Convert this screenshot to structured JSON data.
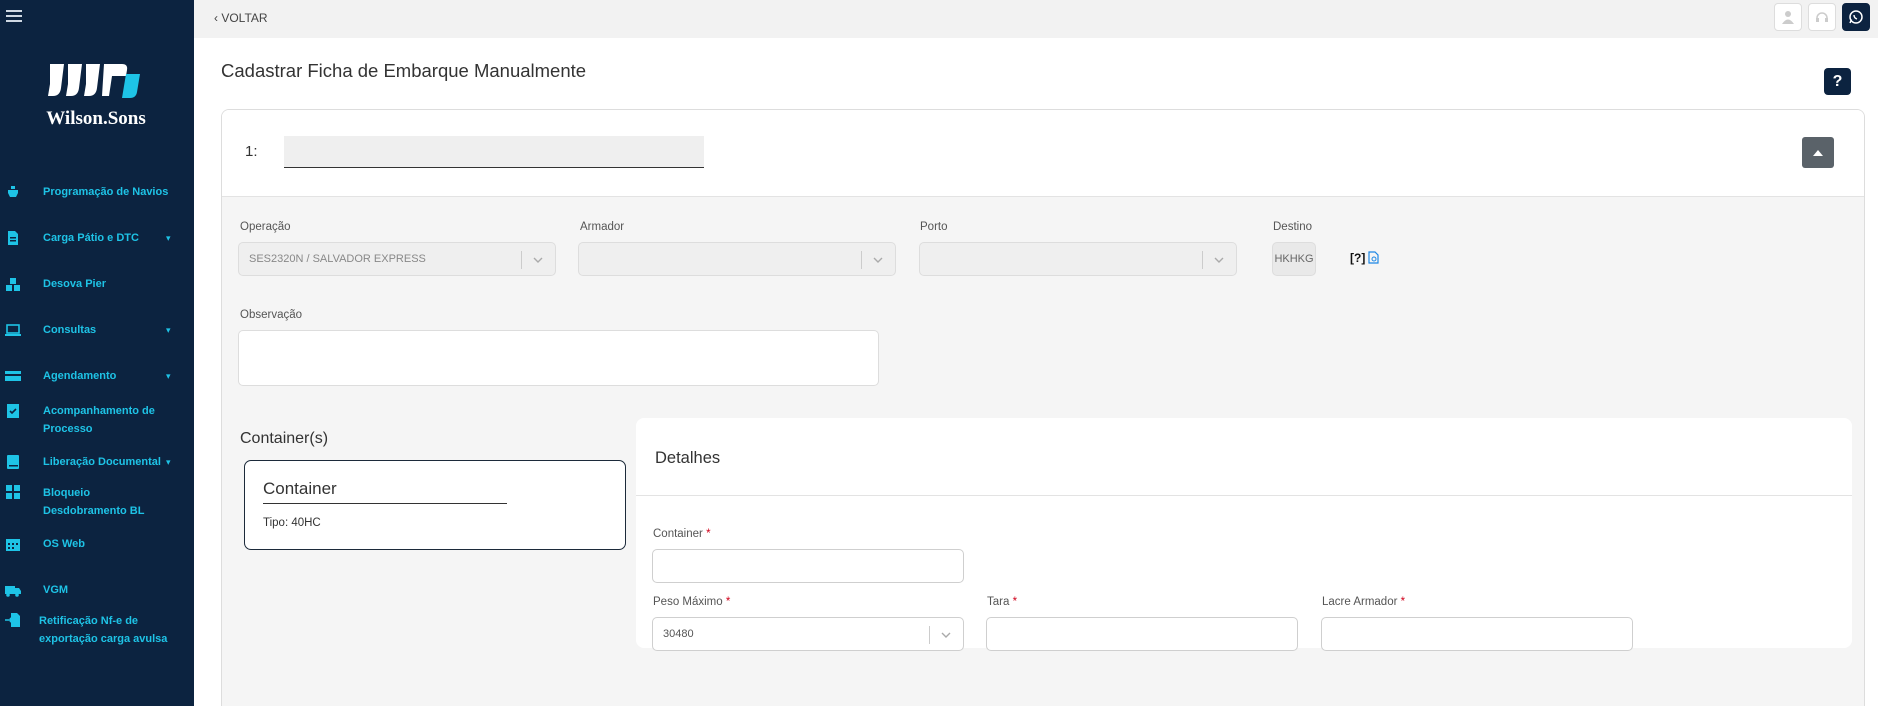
{
  "sidebar": {
    "brand": "Wilson.Sons",
    "items": [
      {
        "label": "Programação de Navios",
        "icon": "ship-icon",
        "caret": false
      },
      {
        "label": "Carga Pátio e DTC",
        "icon": "document-icon",
        "caret": true
      },
      {
        "label": "Desova Pier",
        "icon": "boxes-icon",
        "caret": false
      },
      {
        "label": "Consultas",
        "icon": "laptop-icon",
        "caret": true
      },
      {
        "label": "Agendamento",
        "icon": "card-icon",
        "caret": true
      },
      {
        "label": "Acompanhamento de Processo",
        "icon": "clipboard-check-icon",
        "caret": false
      },
      {
        "label": "Liberação Documental",
        "icon": "book-icon",
        "caret": true
      },
      {
        "label": "Bloqueio Desdobramento BL",
        "icon": "grid-icon",
        "caret": false
      },
      {
        "label": "OS Web",
        "icon": "calendar-icon",
        "caret": false
      },
      {
        "label": "VGM",
        "icon": "truck-icon",
        "caret": false
      },
      {
        "label": "Retificação Nf-e de exportação carga avulsa",
        "icon": "file-import-icon",
        "caret": false
      }
    ]
  },
  "topbar": {
    "back_label": "VOLTAR",
    "icons": [
      "user-icon",
      "support-icon",
      "whatsapp-icon"
    ]
  },
  "page": {
    "title": "Cadastrar Ficha de Embarque Manualmente",
    "help_label": "?"
  },
  "card": {
    "number_label": "1:",
    "number_value": ""
  },
  "form": {
    "operacao_label": "Operação",
    "operacao_value": "SES2320N / SALVADOR EXPRESS",
    "armador_label": "Armador",
    "armador_value": "",
    "porto_label": "Porto",
    "porto_value": "",
    "destino_label": "Destino",
    "destino_value": "HKHKG",
    "destino_help": "[?]",
    "observacao_label": "Observação",
    "observacao_value": ""
  },
  "containers": {
    "section_title": "Container(s)",
    "items": [
      {
        "title": "Container",
        "type": "Tipo: 40HC"
      }
    ]
  },
  "details": {
    "title": "Detalhes",
    "container_label": "Container",
    "container_value": "",
    "peso_label": "Peso Máximo",
    "peso_value": "30480",
    "tara_label": "Tara",
    "tara_value": "",
    "lacre_label": "Lacre Armador",
    "lacre_value": "",
    "required_mark": "*"
  },
  "colors": {
    "sidebar_bg": "#0c2340",
    "sidebar_text": "#1ec3e6",
    "required": "#d0021b",
    "button_dark": "#5a6269"
  }
}
